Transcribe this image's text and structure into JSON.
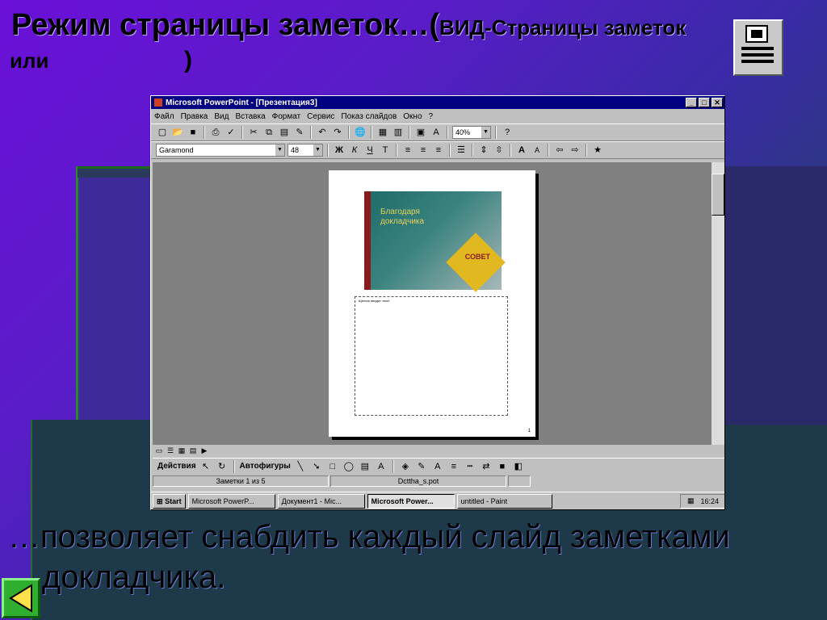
{
  "slide": {
    "title_main": "Режим страницы заметок…(",
    "title_view": "ВИД-Страницы заметок",
    "title_or": "или",
    "title_close": ")",
    "body_line1": "…позволяет снабдить каждый слайд заметками",
    "body_line2": "докладчика.",
    "notes_view_icon": "notes-page-view-icon"
  },
  "window": {
    "title": "Microsoft PowerPoint - [Презентация3]",
    "menu": [
      "Файл",
      "Правка",
      "Вид",
      "Вставка",
      "Формат",
      "Сервис",
      "Показ слайдов",
      "Окно",
      "?"
    ],
    "zoom": "40%",
    "font_name": "Garamond",
    "font_size": "48",
    "format_buttons": [
      "Ж",
      "К",
      "Ч",
      "Т"
    ],
    "page": {
      "slide_title": "Благодаря докладчика",
      "slide_badge": "СОВЕТ",
      "notes_text": "Щелчок вводит текст",
      "page_number": "1"
    },
    "drawbar": {
      "actions": "Действия",
      "autoshapes": "Автофигуры"
    },
    "status": {
      "slide_info": "Заметки 1 из 5",
      "template": "Dcttha_s.pot"
    },
    "taskbar": {
      "start": "Start",
      "tasks": [
        "Microsoft PowerP...",
        "Документ1 - Mic...",
        "Microsoft Power...",
        "untitled - Paint"
      ],
      "clock": "16:24"
    }
  },
  "colors": {
    "accent_titlebar": "#000080",
    "nav_button": "#2fae2f"
  }
}
